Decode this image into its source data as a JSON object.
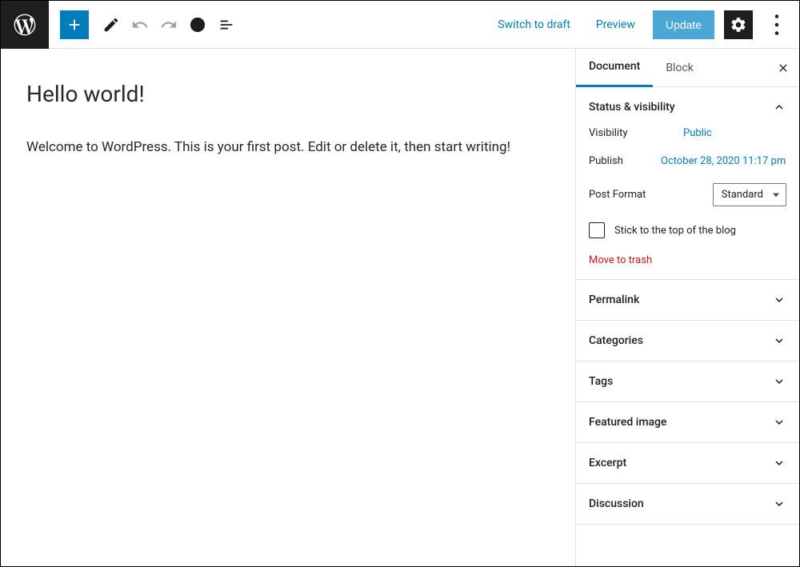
{
  "header": {
    "switch_draft": "Switch to draft",
    "preview": "Preview",
    "update": "Update"
  },
  "editor": {
    "title": "Hello world!",
    "content": "Welcome to WordPress. This is your first post. Edit or delete it, then start writing!"
  },
  "sidebar": {
    "tabs": {
      "document": "Document",
      "block": "Block"
    },
    "status": {
      "title": "Status & visibility",
      "visibility_label": "Visibility",
      "visibility_value": "Public",
      "publish_label": "Publish",
      "publish_value": "October 28, 2020 11:17 pm",
      "format_label": "Post Format",
      "format_value": "Standard",
      "sticky_label": "Stick to the top of the blog",
      "trash": "Move to trash"
    },
    "panels": {
      "permalink": "Permalink",
      "categories": "Categories",
      "tags": "Tags",
      "featured_image": "Featured image",
      "excerpt": "Excerpt",
      "discussion": "Discussion"
    }
  }
}
